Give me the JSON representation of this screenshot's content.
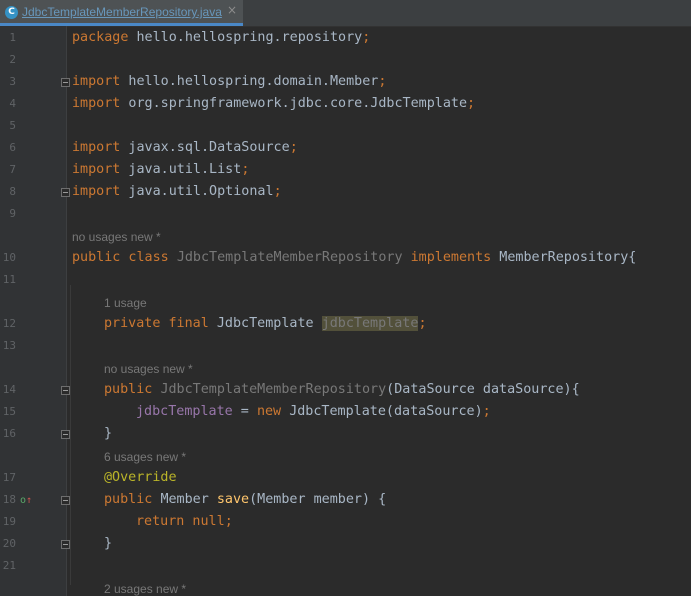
{
  "tab": {
    "title": "JdbcTemplateMemberRepository.java",
    "icon": "C",
    "close": "×"
  },
  "line_numbers": [
    "1",
    "2",
    "3",
    "4",
    "5",
    "6",
    "7",
    "8",
    "9",
    "10",
    "11",
    "12",
    "13",
    "14",
    "15",
    "16",
    "17",
    "18",
    "19",
    "20",
    "21"
  ],
  "code": {
    "l1": {
      "kw": "package",
      "rest": " hello.hellospring.repository",
      "semi": ";"
    },
    "l3": {
      "kw": "import",
      "rest": " hello.hellospring.domain.Member",
      "semi": ";"
    },
    "l4": {
      "kw": "import",
      "rest": " org.springframework.jdbc.core.JdbcTemplate",
      "semi": ";"
    },
    "l6": {
      "kw": "import",
      "rest": " javax.sql.DataSource",
      "semi": ";"
    },
    "l7": {
      "kw": "import",
      "rest": " java.util.List",
      "semi": ";"
    },
    "l8": {
      "kw": "import",
      "rest": " java.util.Optional",
      "semi": ";"
    },
    "l10": {
      "kw1": "public class ",
      "cls": "JdbcTemplateMemberRepository",
      "kw2": " implements ",
      "iface": "MemberRepository{"
    },
    "l12": {
      "kw": "private final ",
      "type": "JdbcTemplate ",
      "field": "jdbcTemplate",
      "semi": ";"
    },
    "l14": {
      "kw": "public ",
      "ctor": "JdbcTemplateMemberRepository",
      "rest": "(DataSource dataSource){"
    },
    "l15": {
      "field": "jdbcTemplate",
      "eq": " = ",
      "kw": "new ",
      "rest": "JdbcTemplate(dataSource)",
      "semi": ";"
    },
    "l16": "}",
    "l17": "@Override",
    "l18": {
      "kw": "public ",
      "type": "Member ",
      "method": "save",
      "rest": "(Member member) {"
    },
    "l19": {
      "kw": "return null",
      "semi": ";"
    },
    "l20": "}"
  },
  "hints": {
    "h10": "no usages   new *",
    "h12": "1 usage",
    "h14": "no usages   new *",
    "h17": "6 usages   new *",
    "h22": "2 usages   new *"
  },
  "gutter_icons": {
    "override": "o↑"
  }
}
